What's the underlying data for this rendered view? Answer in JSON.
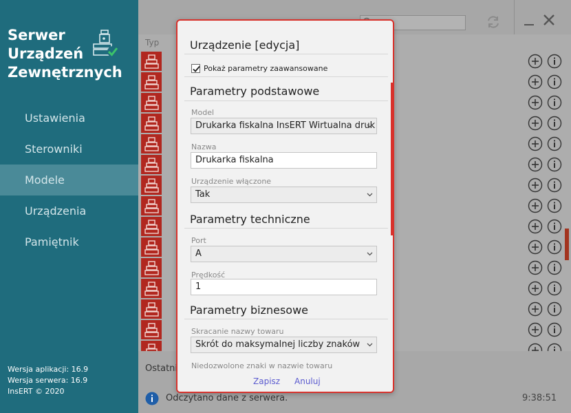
{
  "sidebar": {
    "title_lines": [
      "Serwer",
      "Urządzeń",
      "Zewnętrznych"
    ],
    "nav": [
      {
        "label": "Ustawienia"
      },
      {
        "label": "Sterowniki"
      },
      {
        "label": "Modele"
      },
      {
        "label": "Urządzenia"
      },
      {
        "label": "Pamiętnik"
      }
    ],
    "active_index": 2,
    "version": {
      "app": "Wersja aplikacji: 16.9",
      "server": "Wersja serwera: 16.9",
      "copyright": "InsERT © 2020"
    }
  },
  "main": {
    "column_header": "Typ",
    "row_count": 15,
    "row_text": "",
    "bottom": {
      "last_label": "Ostatni",
      "status_text": "Odczytano dane z serwera.",
      "time": "9:38:51"
    }
  },
  "modal": {
    "title": "Urządzenie [edycja]",
    "advanced_checkbox": {
      "label": "Pokaż parametry zaawansowane",
      "checked": true
    },
    "sections": {
      "basic": "Parametry podstawowe",
      "technical": "Parametry techniczne",
      "business": "Parametry biznesowe"
    },
    "fields": {
      "model": {
        "label": "Model",
        "value": "Drukarka fiskalna InsERT Wirtualna druk"
      },
      "name": {
        "label": "Nazwa",
        "value": "Drukarka fiskalna"
      },
      "enabled": {
        "label": "Urządzenie włączone",
        "value": "Tak"
      },
      "port": {
        "label": "Port",
        "value": "A"
      },
      "speed": {
        "label": "Prędkość",
        "value": "1"
      },
      "shortening": {
        "label": "Skracanie nazwy towaru",
        "value": "Skrót do maksymalnej liczby znaków"
      },
      "forbidden": {
        "label": "Niedozwolone znaki w nazwie towaru"
      }
    },
    "buttons": {
      "save": "Zapisz",
      "cancel": "Anuluj"
    }
  },
  "colors": {
    "sidebar": "#1f6c7d",
    "sidebar_active": "#4a8a98",
    "accent_red": "#d8322c",
    "link": "#5a5acf"
  }
}
